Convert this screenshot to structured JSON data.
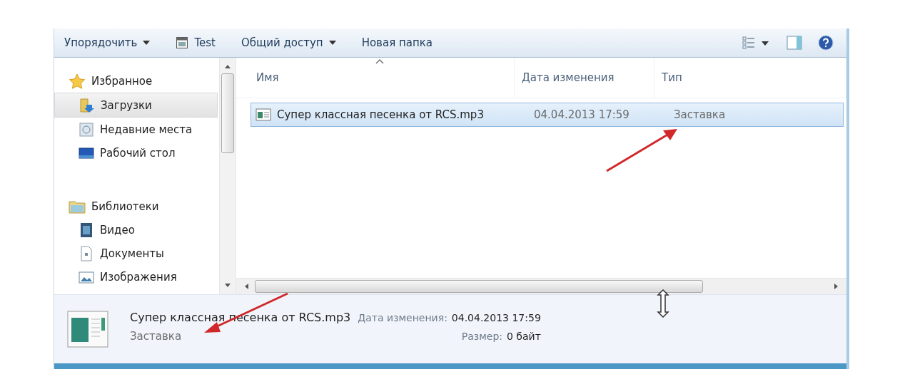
{
  "toolbar": {
    "items": [
      {
        "kind": "command",
        "label": "Упорядочить",
        "dropdown": true
      },
      {
        "kind": "program",
        "label": "Test",
        "dropdown": false
      },
      {
        "kind": "command",
        "label": "Общий доступ",
        "dropdown": true
      },
      {
        "kind": "command",
        "label": "Новая папка",
        "dropdown": false
      }
    ]
  },
  "sidebar": {
    "groups": [
      {
        "label": "Избранное",
        "children": [
          {
            "label": "Загрузки",
            "selected": true
          },
          {
            "label": "Недавние места",
            "selected": false
          },
          {
            "label": "Рабочий стол",
            "selected": false
          }
        ]
      },
      {
        "label": "Библиотеки",
        "children": [
          {
            "label": "Видео",
            "selected": false
          },
          {
            "label": "Документы",
            "selected": false
          },
          {
            "label": "Изображения",
            "selected": false
          }
        ]
      }
    ]
  },
  "table": {
    "columns": [
      {
        "label": "Имя",
        "sorted": true
      },
      {
        "label": "Дата изменения",
        "sorted": false
      },
      {
        "label": "Тип",
        "sorted": false
      }
    ],
    "rows": [
      {
        "name": "Супер классная песенка от RCS.mp3",
        "date": "04.04.2013 17:59",
        "type": "Заставка",
        "selected": true
      }
    ]
  },
  "details": {
    "name": "Супер классная песенка от RCS.mp3",
    "type": "Заставка",
    "fields": [
      {
        "label": "Дата изменения:",
        "value": "04.04.2013 17:59"
      },
      {
        "label": "Размер:",
        "value": "0 байт"
      }
    ]
  }
}
